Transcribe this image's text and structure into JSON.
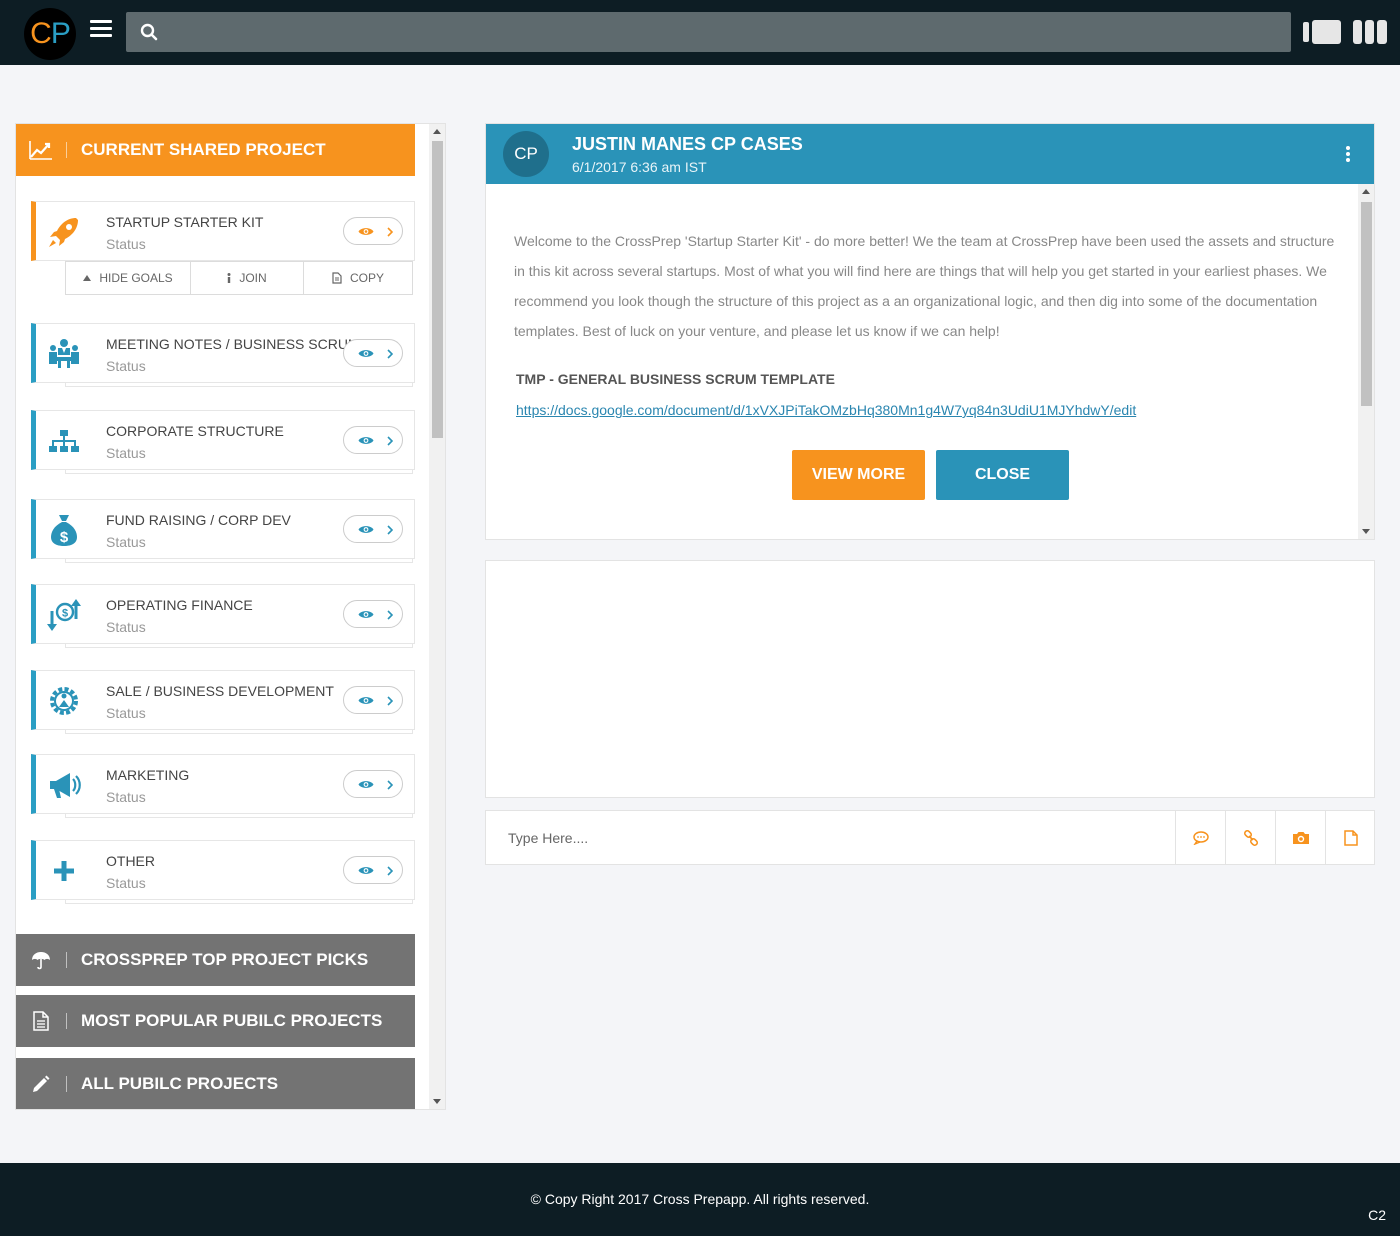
{
  "header": {
    "logo_c": "C",
    "logo_p": "P",
    "search_placeholder": ""
  },
  "sidebar": {
    "current_section": "CURRENT SHARED PROJECT",
    "items": [
      {
        "title": "STARTUP STARTER KIT",
        "status": "Status",
        "icon": "rocket-icon"
      },
      {
        "title": "MEETING NOTES / BUSINESS SCRUM",
        "status": "Status",
        "icon": "meeting-icon"
      },
      {
        "title": "CORPORATE STRUCTURE",
        "status": "Status",
        "icon": "org-chart-icon"
      },
      {
        "title": "FUND RAISING / CORP DEV",
        "status": "Status",
        "icon": "money-bag-icon"
      },
      {
        "title": "OPERATING FINANCE",
        "status": "Status",
        "icon": "finance-icon"
      },
      {
        "title": "SALE / BUSINESS DEVELOPMENT",
        "status": "Status",
        "icon": "gear-person-icon"
      },
      {
        "title": "MARKETING",
        "status": "Status",
        "icon": "megaphone-icon"
      },
      {
        "title": "OTHER",
        "status": "Status",
        "icon": "plus-icon"
      }
    ],
    "goal_actions": {
      "hide_goals": "HIDE GOALS",
      "join": "JOIN",
      "copy": "COPY"
    },
    "top_picks": "CROSSPREP TOP PROJECT PICKS",
    "most_popular": "MOST POPULAR PUBILC PROJECTS",
    "all_public": "ALL PUBILC PROJECTS"
  },
  "card": {
    "avatar": "CP",
    "title": "JUSTIN MANES CP CASES",
    "date": "6/1/2017 6:36 am IST",
    "description": "Welcome to the CrossPrep 'Startup Starter Kit' - do more better! We the team at CrossPrep have been used the assets and structure in this kit across several startups. Most of what you will find here are things that will help you get started in your earliest phases. We recommend you look though the structure of this project as a an organizational logic, and then dig into some of the documentation templates. Best of luck on your venture, and please let us know if we can help!",
    "template_title": "TMP - GENERAL BUSINESS SCRUM TEMPLATE",
    "template_link": "https://docs.google.com/document/d/1xVXJPiTakOMzbHq380Mn1g4W7yq84n3UdiU1MJYhdwY/edit",
    "view_more": "VIEW MORE",
    "close": "CLOSE"
  },
  "composer": {
    "placeholder": "Type Here...."
  },
  "footer": {
    "copyright": "© Copy Right 2017 Cross Prepapp. All rights reserved.",
    "badge": "C2"
  },
  "colors": {
    "brand_orange": "#f7931e",
    "brand_blue": "#2a93b8",
    "topbar": "#0d1d24",
    "section_gray": "#737373"
  }
}
